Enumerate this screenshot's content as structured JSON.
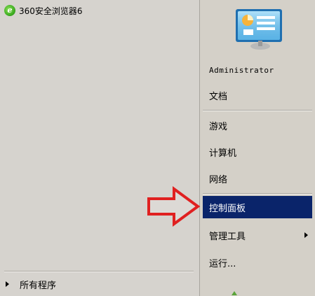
{
  "left_pane": {
    "programs": [
      {
        "label": "360安全浏览器6",
        "icon": "browser-360-icon",
        "icon_glyph": "e"
      }
    ],
    "all_programs_label": "所有程序"
  },
  "right_pane": {
    "user_picture_icon": "control-panel-user-icon",
    "username": "Administrator",
    "items": [
      {
        "label": "文档"
      },
      {
        "label": "游戏"
      },
      {
        "label": "计算机"
      },
      {
        "label": "网络"
      },
      {
        "label": "控制面板",
        "selected": true
      },
      {
        "label": "管理工具",
        "has_submenu": true
      },
      {
        "label": "运行..."
      }
    ]
  },
  "annotation": {
    "arrow_color": "#e02020",
    "arrow_icon": "red-right-arrow-icon"
  },
  "colors": {
    "menu_background": "#d4d0c8",
    "selection": "#0a246a"
  }
}
